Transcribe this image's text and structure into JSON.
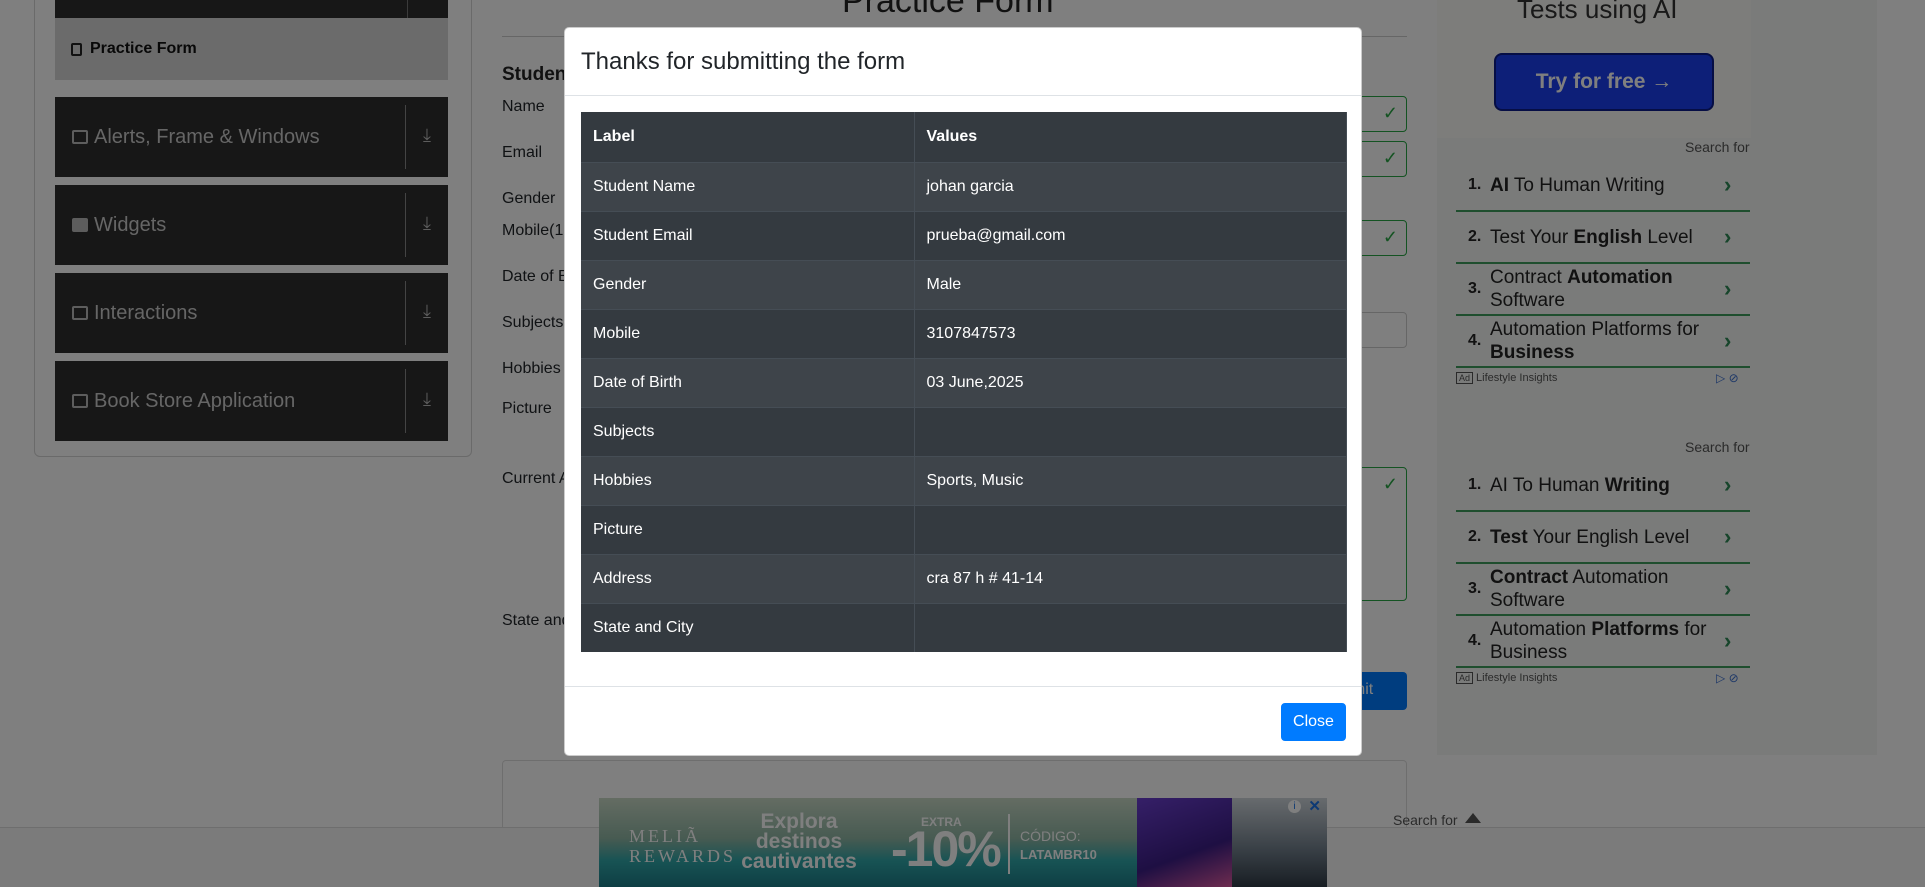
{
  "sidebar": {
    "active_item": "Practice Form",
    "groups": [
      {
        "label": "Alerts, Frame & Windows"
      },
      {
        "label": "Widgets"
      },
      {
        "label": "Interactions"
      },
      {
        "label": "Book Store Application"
      }
    ]
  },
  "form": {
    "title": "Practice Form",
    "subtitle": "Studen",
    "labels": {
      "name": "Name",
      "email": "Email",
      "gender": "Gender",
      "mobile": "Mobile(1(",
      "dob": "Date of B",
      "subjects": "Subjects",
      "hobbies": "Hobbies",
      "picture": "Picture",
      "address": "Current A",
      "state": "State and"
    },
    "submit_label": "bmit"
  },
  "ads": {
    "top_text": "Tests using AI",
    "try_button": "Try for free →",
    "search_for": "Search for",
    "list1": [
      {
        "num": "1.",
        "pre": "",
        "bold": "AI",
        "post": " To Human Writing"
      },
      {
        "num": "2.",
        "pre": "Test Your ",
        "bold": "English",
        "post": " Level"
      },
      {
        "num": "3.",
        "pre": "Contract ",
        "bold": "Automation",
        "post": " Software"
      },
      {
        "num": "4.",
        "pre": "Automation Platforms for ",
        "bold": "Business",
        "post": ""
      }
    ],
    "list2": [
      {
        "num": "1.",
        "pre": "AI To Human ",
        "bold": "Writing",
        "post": ""
      },
      {
        "num": "2.",
        "pre": "",
        "bold": "Test",
        "post": " Your English Level"
      },
      {
        "num": "3.",
        "pre": "",
        "bold": "Contract",
        "post": " Automation Software"
      },
      {
        "num": "4.",
        "pre": "Automation ",
        "bold": "Platforms",
        "post": " for Business"
      }
    ],
    "footer_label": "Lifestyle Insights",
    "ad_badge": "Ad"
  },
  "footer_ad": {
    "search_for": "Search for",
    "brand_line1": "MELIÃ",
    "brand_line2": "REWARDS",
    "headline": "Explora destinos cautivantes",
    "extra": "EXTRA",
    "discount": "-10%",
    "code_label": "CÓDIGO:",
    "code_value": "LATAMBR10"
  },
  "modal": {
    "title": "Thanks for submitting the form",
    "columns": [
      "Label",
      "Values"
    ],
    "rows": [
      {
        "label": "Student Name",
        "value": "johan garcia"
      },
      {
        "label": "Student Email",
        "value": "prueba@gmail.com"
      },
      {
        "label": "Gender",
        "value": "Male"
      },
      {
        "label": "Mobile",
        "value": "3107847573"
      },
      {
        "label": "Date of Birth",
        "value": "03 June,2025"
      },
      {
        "label": "Subjects",
        "value": ""
      },
      {
        "label": "Hobbies",
        "value": "Sports, Music"
      },
      {
        "label": "Picture",
        "value": ""
      },
      {
        "label": "Address",
        "value": "cra 87 h # 41-14"
      },
      {
        "label": "State and City",
        "value": ""
      }
    ],
    "close_label": "Close"
  }
}
